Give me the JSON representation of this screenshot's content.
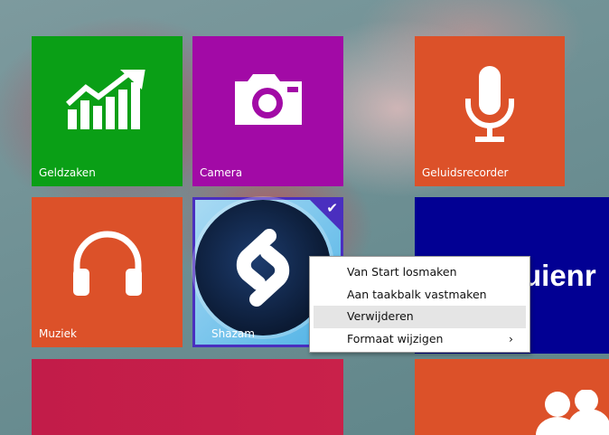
{
  "tiles": [
    {
      "label": "Geldzaken",
      "color": "#0a9f16",
      "icon": "chart-up-icon"
    },
    {
      "label": "Camera",
      "color": "#a20aa6",
      "icon": "camera-icon"
    },
    {
      "label": "Geluidsrecorder",
      "color": "#dc5129",
      "icon": "microphone-icon"
    },
    {
      "label": "Muziek",
      "color": "#dc5129",
      "icon": "headphones-icon"
    },
    {
      "label": "Shazam",
      "color": "#5bb7e6",
      "icon": "shazam-icon",
      "selected": true
    },
    {
      "label": "uienr",
      "color": "#020093"
    },
    {
      "color": "#c41a46"
    },
    {
      "color": "#dc5129",
      "icon": "people-icon"
    }
  ],
  "context_menu": {
    "items": [
      {
        "label": "Van Start losmaken"
      },
      {
        "label": "Aan taakbalk vastmaken"
      },
      {
        "label": "Verwijderen",
        "highlighted": true
      },
      {
        "label": "Formaat wijzigen",
        "submenu": "›"
      }
    ]
  }
}
